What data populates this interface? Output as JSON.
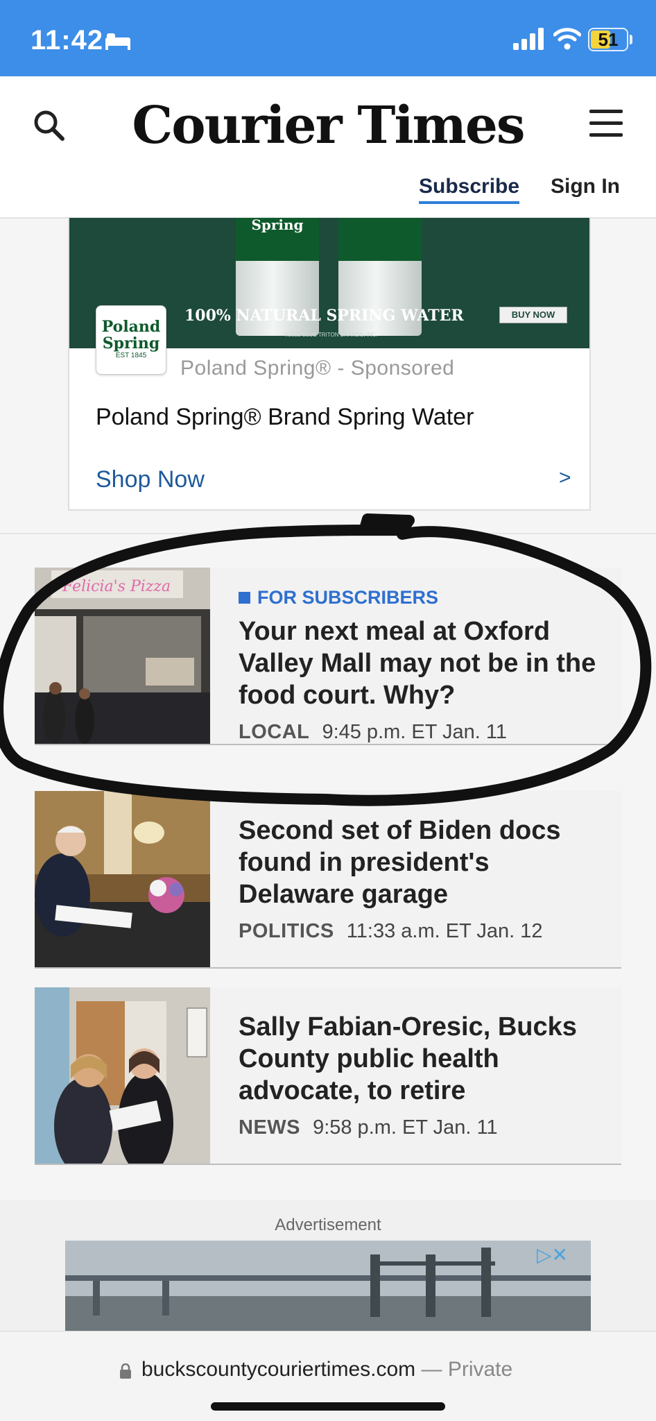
{
  "status_bar": {
    "time": "11:42",
    "battery_level": "51",
    "battery_fraction": 0.51
  },
  "header": {
    "logo": "Courier Times",
    "subscribe_label": "Subscribe",
    "sign_in_label": "Sign In"
  },
  "sponsored_ad": {
    "banner_headline": "100% NATURAL SPRING WATER",
    "banner_button": "BUY NOW",
    "banner_copyright": "©2022 BLUE TRITON BRANDS, INC.",
    "brand_logo_line1": "Poland",
    "brand_logo_line2": "Spring",
    "brand_logo_year": "EST 1845",
    "bottle_label": "Spring",
    "sponsor_line": "Poland Spring® - Sponsored",
    "title": "Poland Spring® Brand Spring Water",
    "cta": "Shop Now",
    "cta_arrow": ">"
  },
  "stories": [
    {
      "label": "FOR SUBSCRIBERS",
      "headline": "Your next meal at Oxford Valley Mall may not be in the food court. Why?",
      "section": "LOCAL",
      "timestamp": "9:45 p.m. ET Jan. 11",
      "thumb_sign": "Felicia's Pizza"
    },
    {
      "headline": "Second set of Biden docs found in president's Delaware garage",
      "section": "POLITICS",
      "timestamp": "11:33 a.m. ET Jan. 12"
    },
    {
      "headline": "Sally Fabian-Oresic, Bucks County public health advocate, to retire",
      "section": "NEWS",
      "timestamp": "9:58 p.m. ET Jan. 11"
    }
  ],
  "advertisement": {
    "label": "Advertisement",
    "adchoices": "▷✕"
  },
  "url_bar": {
    "domain": "buckscountycouriertimes.com",
    "private_suffix": " — Private"
  },
  "colors": {
    "status_bar": "#3d8ee8",
    "link_blue": "#2f6fd0",
    "ad_green": "#1d4a3a"
  },
  "icons": [
    "bed-icon",
    "signal-icon",
    "wifi-icon",
    "battery-icon",
    "search-icon",
    "hamburger-menu-icon",
    "chevron-right-icon",
    "lock-icon",
    "adchoices-icon"
  ]
}
